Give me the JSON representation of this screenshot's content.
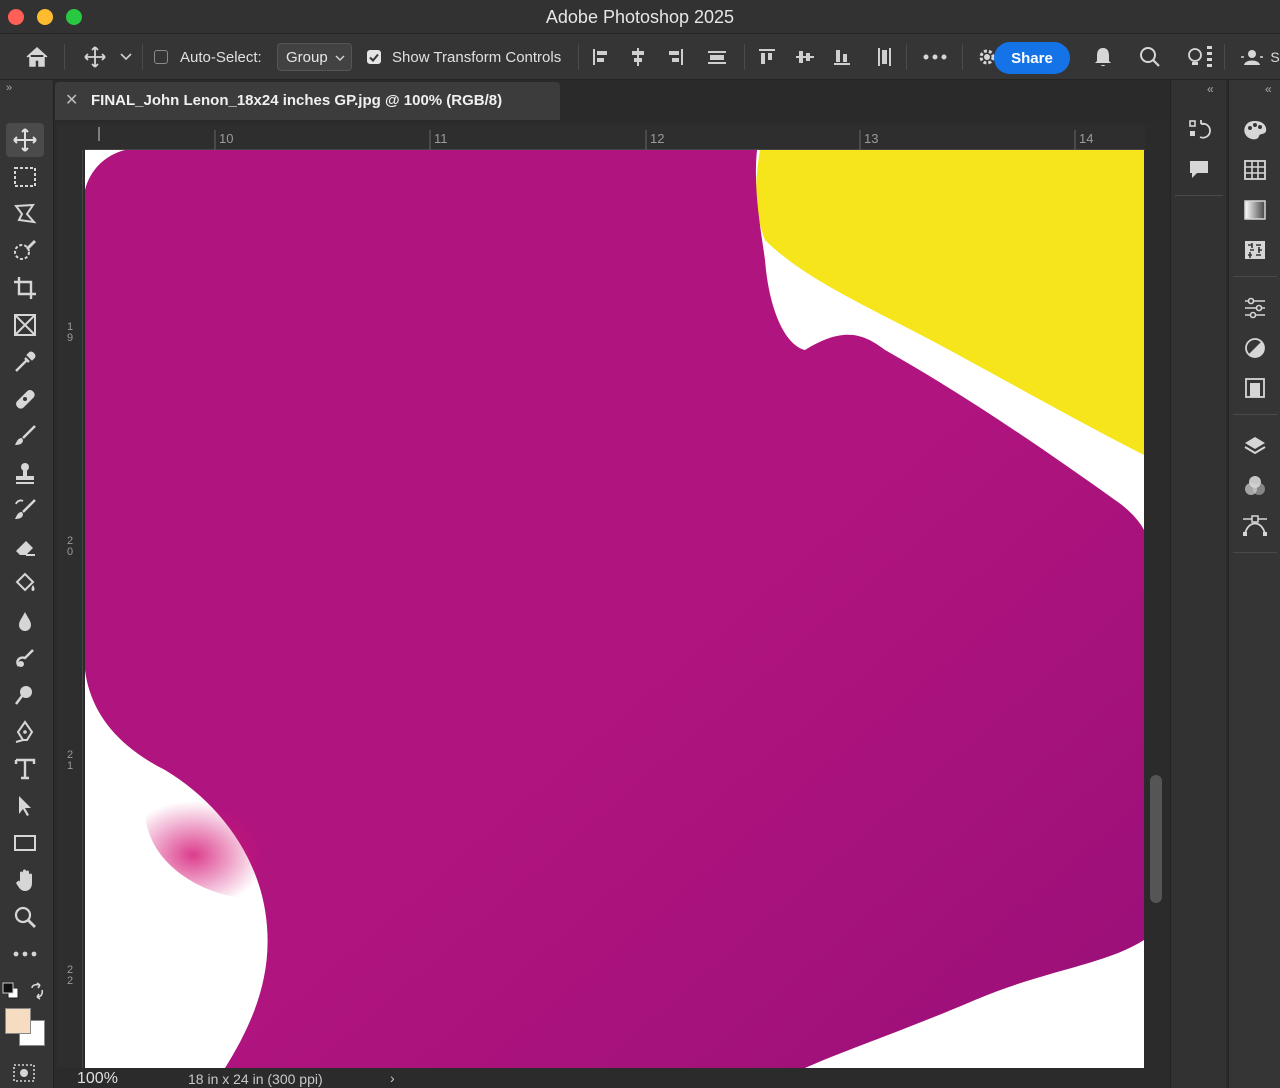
{
  "app": {
    "title": "Adobe Photoshop 2025"
  },
  "options_bar": {
    "auto_select_label": "Auto-Select:",
    "auto_select_checked": false,
    "auto_select_mode": "Group",
    "show_transform_label": "Show Transform Controls",
    "show_transform_checked": true,
    "share_label": "Share"
  },
  "document": {
    "tab_title": "FINAL_John Lenon_18x24 inches GP.jpg @ 100% (RGB/8)",
    "zoom": "100%",
    "info": "18 in x 24 in (300 ppi)"
  },
  "rulers": {
    "top": [
      "10",
      "11",
      "12",
      "13",
      "14"
    ],
    "left": [
      [
        "1",
        "9"
      ],
      [
        "2",
        "0"
      ],
      [
        "2",
        "1"
      ],
      [
        "2",
        "2"
      ]
    ]
  },
  "tools": [
    "move-tool",
    "marquee-tool",
    "lasso-tool",
    "object-select-tool",
    "crop-tool",
    "frame-tool",
    "eyedropper-tool",
    "healing-tool",
    "brush-tool",
    "stamp-tool",
    "history-brush-tool",
    "eraser-tool",
    "paint-bucket-tool",
    "blur-tool",
    "smudge-tool",
    "dodge-tool",
    "pen-tool",
    "type-tool",
    "path-select-tool",
    "rectangle-tool",
    "hand-tool",
    "zoom-tool",
    "more-tools"
  ],
  "colors": {
    "magenta": "#b0147e",
    "magenta_dark": "#9a0f78",
    "pink": "#d51a78",
    "yellow": "#f5e51a",
    "accent": "#1473e6",
    "foreground_swatch": "#f6dcc0",
    "background_swatch": "#ffffff"
  }
}
